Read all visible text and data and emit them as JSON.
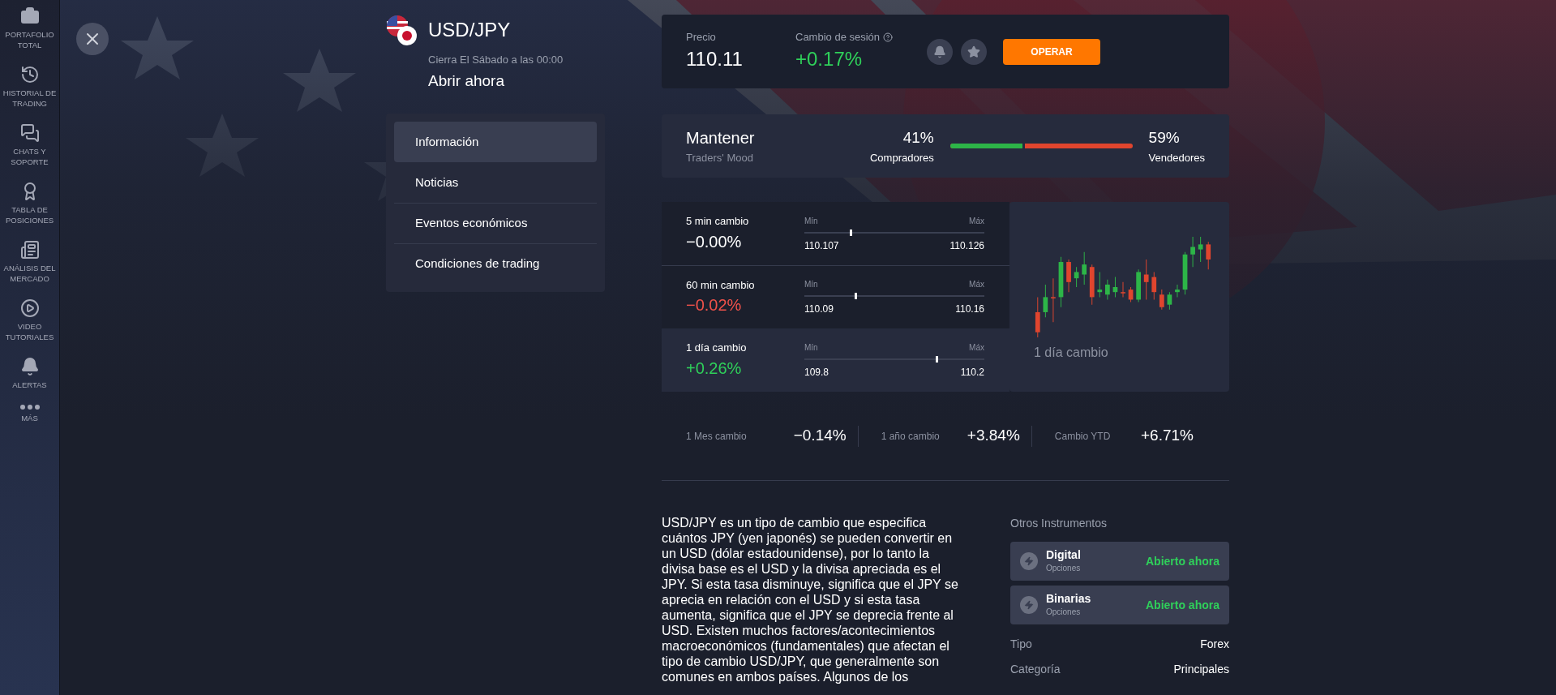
{
  "sidebar": {
    "items": [
      {
        "kind": "briefcase",
        "label": "PORTAFOLIO TOTAL"
      },
      {
        "kind": "history",
        "label": "HISTORIAL DE TRADING"
      },
      {
        "kind": "chat",
        "label": "CHATS Y SOPORTE"
      },
      {
        "kind": "award",
        "label": "TABLA DE POSICIONES"
      },
      {
        "kind": "news",
        "label": "ANÁLISIS DEL MERCADO"
      },
      {
        "kind": "play",
        "label": "VIDEO TUTORIALES"
      },
      {
        "kind": "bell",
        "label": "ALERTAS"
      },
      {
        "kind": "more",
        "label": "MÁS"
      }
    ]
  },
  "header": {
    "title": "USD/JPY",
    "schedule": "Cierra El Sábado a las 00:00",
    "status": "Abrir ahora"
  },
  "menu": [
    {
      "label": "Información",
      "selected": true
    },
    {
      "label": "Noticias",
      "selected": false
    },
    {
      "label": "Eventos económicos",
      "selected": false
    },
    {
      "label": "Condiciones de trading",
      "selected": false
    }
  ],
  "quote": {
    "price_label": "Precio",
    "price": "110.11",
    "change_label": "Cambio de sesión",
    "change": "+0.17%",
    "button": "OPERAR"
  },
  "mood": {
    "title": "Mantener",
    "subtitle": "Traders' Mood",
    "buyers": "41%",
    "buyers_label": "Compradores",
    "sellers": "59%",
    "sellers_label": "Vendedores",
    "level": 0.41
  },
  "ranges": [
    {
      "label": "5 min cambio",
      "value": "−0.00%",
      "color": "#ffffff",
      "min_label": "Mín",
      "max_label": "Máx",
      "min": "110.107",
      "max": "110.126",
      "level": 0.25,
      "selected": false
    },
    {
      "label": "60 min cambio",
      "value": "−0.02%",
      "color": "#f0524a",
      "min_label": "Mín",
      "max_label": "Máx",
      "min": "110.09",
      "max": "110.16",
      "level": 0.28,
      "selected": false
    },
    {
      "label": "1 día cambio",
      "value": "+0.26%",
      "color": "#2fd05a",
      "min_label": "Mín",
      "max_label": "Máx",
      "min": "109.8",
      "max": "110.2",
      "level": 0.73,
      "selected": true
    }
  ],
  "chart_caption": "1 día cambio",
  "period_stats": [
    {
      "label": "1 Mes cambio",
      "value": "−0.14%"
    },
    {
      "label": "1 año cambio",
      "value": "+3.84%"
    },
    {
      "label": "Cambio YTD",
      "value": "+6.71%"
    }
  ],
  "description": "USD/JPY es un tipo de cambio que especifica cuántos JPY (yen japonés) se pueden convertir en un USD (dólar estadounidense), por lo tanto la divisa base es el USD y la divisa apreciada es el JPY. Si esta tasa disminuye, significa que el JPY se aprecia en relación con el USD y si esta tasa aumenta, significa que el JPY se deprecia frente al USD. Existen muchos factores/acontecimientos macroeconómicos (fundamentales) que afectan el tipo de cambio USD/JPY, que generalmente son comunes en ambos países. Algunos de los",
  "other_instruments": {
    "title": "Otros Instrumentos",
    "items": [
      {
        "name": "Digital",
        "type": "Opciones",
        "status": "Abierto ahora"
      },
      {
        "name": "Binarias",
        "type": "Opciones",
        "status": "Abierto ahora"
      }
    ]
  },
  "details": [
    {
      "label": "Tipo",
      "value": "Forex"
    },
    {
      "label": "Categoría",
      "value": "Principales"
    }
  ]
}
